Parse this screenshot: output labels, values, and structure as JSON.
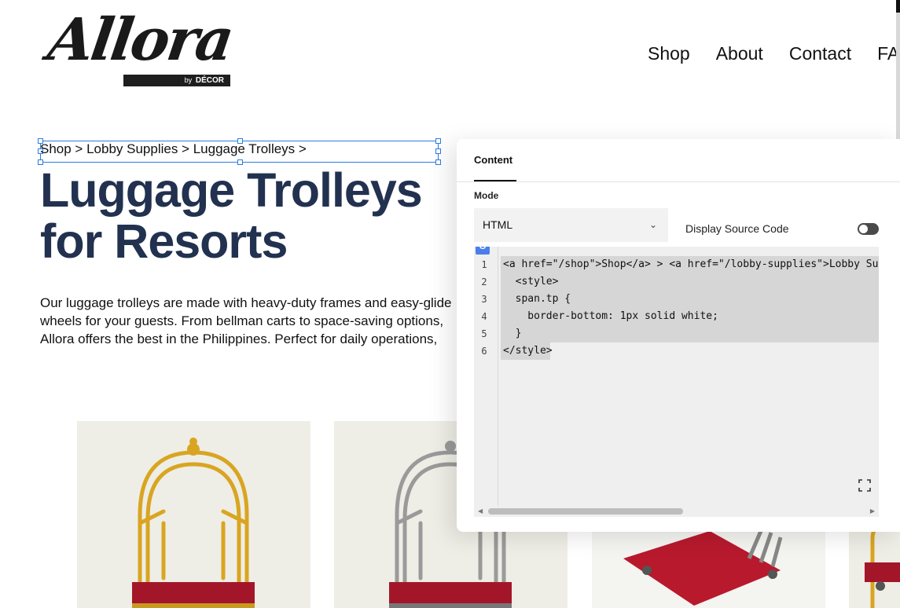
{
  "header": {
    "logo_text": "Allora",
    "logo_by": "by",
    "logo_brand": "DÉCOR",
    "nav": [
      "Shop",
      "About",
      "Contact",
      "FAQ"
    ]
  },
  "page": {
    "breadcrumb": "Shop > Lobby Supplies > Luggage Trolleys >",
    "title": "Luggage Trolleys for Resorts",
    "intro": "Our luggage trolleys are made with heavy-duty frames and easy-glide wheels for your guests. From bellman carts to space-saving options, Allora offers the best in the Philippines. Perfect for daily operations, available in bulk."
  },
  "editor_panel": {
    "tab": "Content",
    "mode_label": "Mode",
    "mode_value": "HTML",
    "toggle_label": "Display Source Code",
    "toggle_on": false,
    "code_lines": [
      {
        "num": "1",
        "text": "<a href=\"/shop\">Shop</a> > <a href=\"/lobby-supplies\">Lobby Supp"
      },
      {
        "num": "2",
        "text": "  <style>"
      },
      {
        "num": "3",
        "text": "  span.tp {"
      },
      {
        "num": "4",
        "text": "    border-bottom: 1px solid white;"
      },
      {
        "num": "5",
        "text": "  }"
      },
      {
        "num": "6",
        "text": "</style>"
      }
    ]
  },
  "colors": {
    "title": "#22314f",
    "selection": "#2a7de1",
    "card_bg": "#eeeee6",
    "trolley_red": "#a3162a",
    "trolley_gold": "#d9a521"
  }
}
